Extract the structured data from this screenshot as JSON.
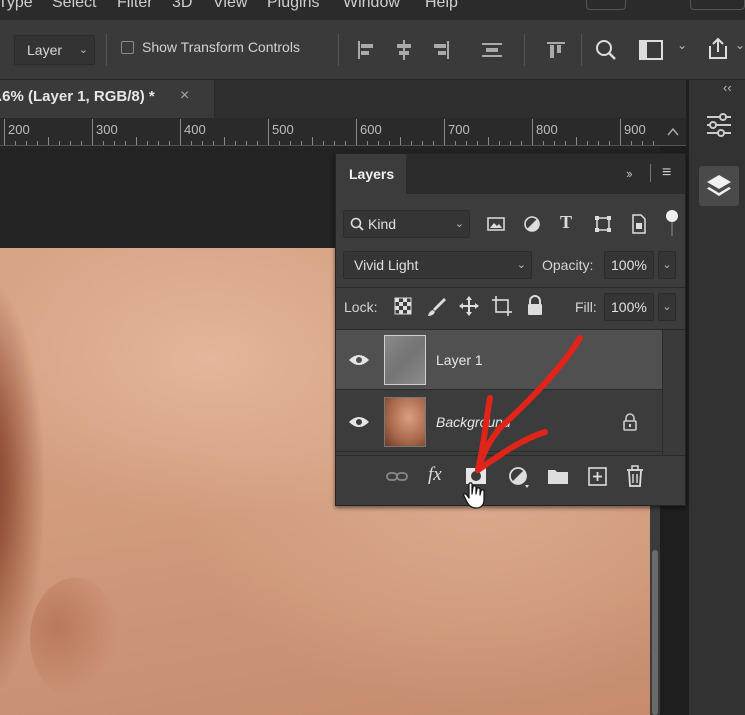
{
  "menubar": {
    "items": [
      "Type",
      "Select",
      "Filter",
      "3D",
      "View",
      "Plugins",
      "Window",
      "Help"
    ]
  },
  "options_bar": {
    "tool_select": "Layer",
    "show_transform_controls_label": "Show Transform Controls",
    "show_transform_controls_checked": false
  },
  "document_tab": {
    "title": ".6% (Layer 1, RGB/8) *",
    "close_glyph": "×"
  },
  "ruler": {
    "labels": [
      "200",
      "300",
      "400",
      "500",
      "600",
      "700",
      "800",
      "900"
    ]
  },
  "dock": {
    "collapse_glyph": "‹‹",
    "buttons": [
      "adjustments-sliders-icon",
      "layers-stack-icon"
    ]
  },
  "layers_panel": {
    "title": "Layers",
    "collapse_glyph": "››",
    "filter_kind": "Kind",
    "blend_mode": "Vivid Light",
    "opacity_label": "Opacity:",
    "opacity_value": "100%",
    "lock_label": "Lock:",
    "fill_label": "Fill:",
    "fill_value": "100%",
    "layers": [
      {
        "name": "Layer 1",
        "visible": true,
        "selected": true,
        "italic": false,
        "locked": false
      },
      {
        "name": "Background",
        "visible": true,
        "selected": false,
        "italic": true,
        "locked": true
      }
    ],
    "footer_buttons": [
      "link-layers-icon",
      "fx-icon",
      "add-mask-icon",
      "adjustment-layer-icon",
      "new-group-icon",
      "new-layer-icon",
      "delete-icon"
    ],
    "fx_label": "fx"
  },
  "colors": {
    "annotation": "#e0241a",
    "panel_bg": "#3c3c3c",
    "selected_layer": "#505050"
  }
}
